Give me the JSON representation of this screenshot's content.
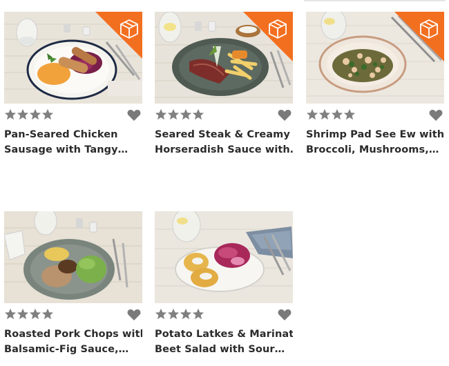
{
  "icons": {
    "star": "star-icon",
    "favorite": "heart-icon",
    "delivery": "box-icon"
  },
  "colors": {
    "star": "#808080",
    "heart": "#7a7a7a",
    "ribbon": "#f36f20",
    "title": "#2b2b2b"
  },
  "recipes": [
    {
      "title_line1": "Pan-Seared Chicken",
      "title_line2": "Sausage with Tangy…",
      "rating": 4,
      "has_ribbon": true
    },
    {
      "title_line1": "Seared Steak & Creamy",
      "title_line2": "Horseradish Sauce with…",
      "rating": 4,
      "has_ribbon": true
    },
    {
      "title_line1": "Shrimp Pad See Ew with",
      "title_line2": "Broccoli, Mushrooms,…",
      "rating": 4,
      "has_ribbon": true
    },
    {
      "title_line1": "Roasted Pork Chops with",
      "title_line2": "Balsamic-Fig Sauce,…",
      "rating": 4,
      "has_ribbon": false
    },
    {
      "title_line1": "Potato Latkes & Marinated",
      "title_line2": "Beet Salad with Sour…",
      "rating": 4,
      "has_ribbon": false
    }
  ]
}
